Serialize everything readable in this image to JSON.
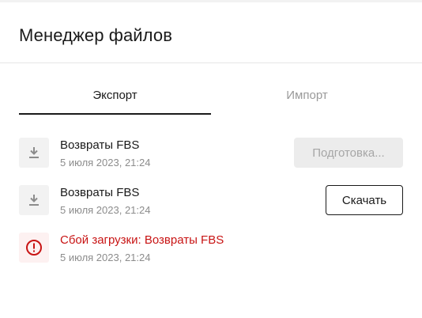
{
  "header": {
    "title": "Менеджер файлов"
  },
  "tabs": [
    {
      "label": "Экспорт",
      "active": true
    },
    {
      "label": "Импорт",
      "active": false
    }
  ],
  "files": [
    {
      "icon": "download-icon",
      "name": "Возвраты FBS",
      "date": "5 июля 2023, 21:24",
      "button_label": "Подготовка...",
      "state": "preparing"
    },
    {
      "icon": "download-icon",
      "name": "Возвраты FBS",
      "date": "5 июля 2023, 21:24",
      "button_label": "Скачать",
      "state": "ready"
    },
    {
      "icon": "error-icon",
      "name": "Сбой загрузки: Возвраты FBS",
      "date": "5 июля 2023, 21:24",
      "state": "error"
    }
  ],
  "colors": {
    "error": "#c81414",
    "muted_text": "#8c8c8c",
    "icon_bg": "#f2f2f2",
    "error_icon_bg": "#fdf1f1"
  }
}
